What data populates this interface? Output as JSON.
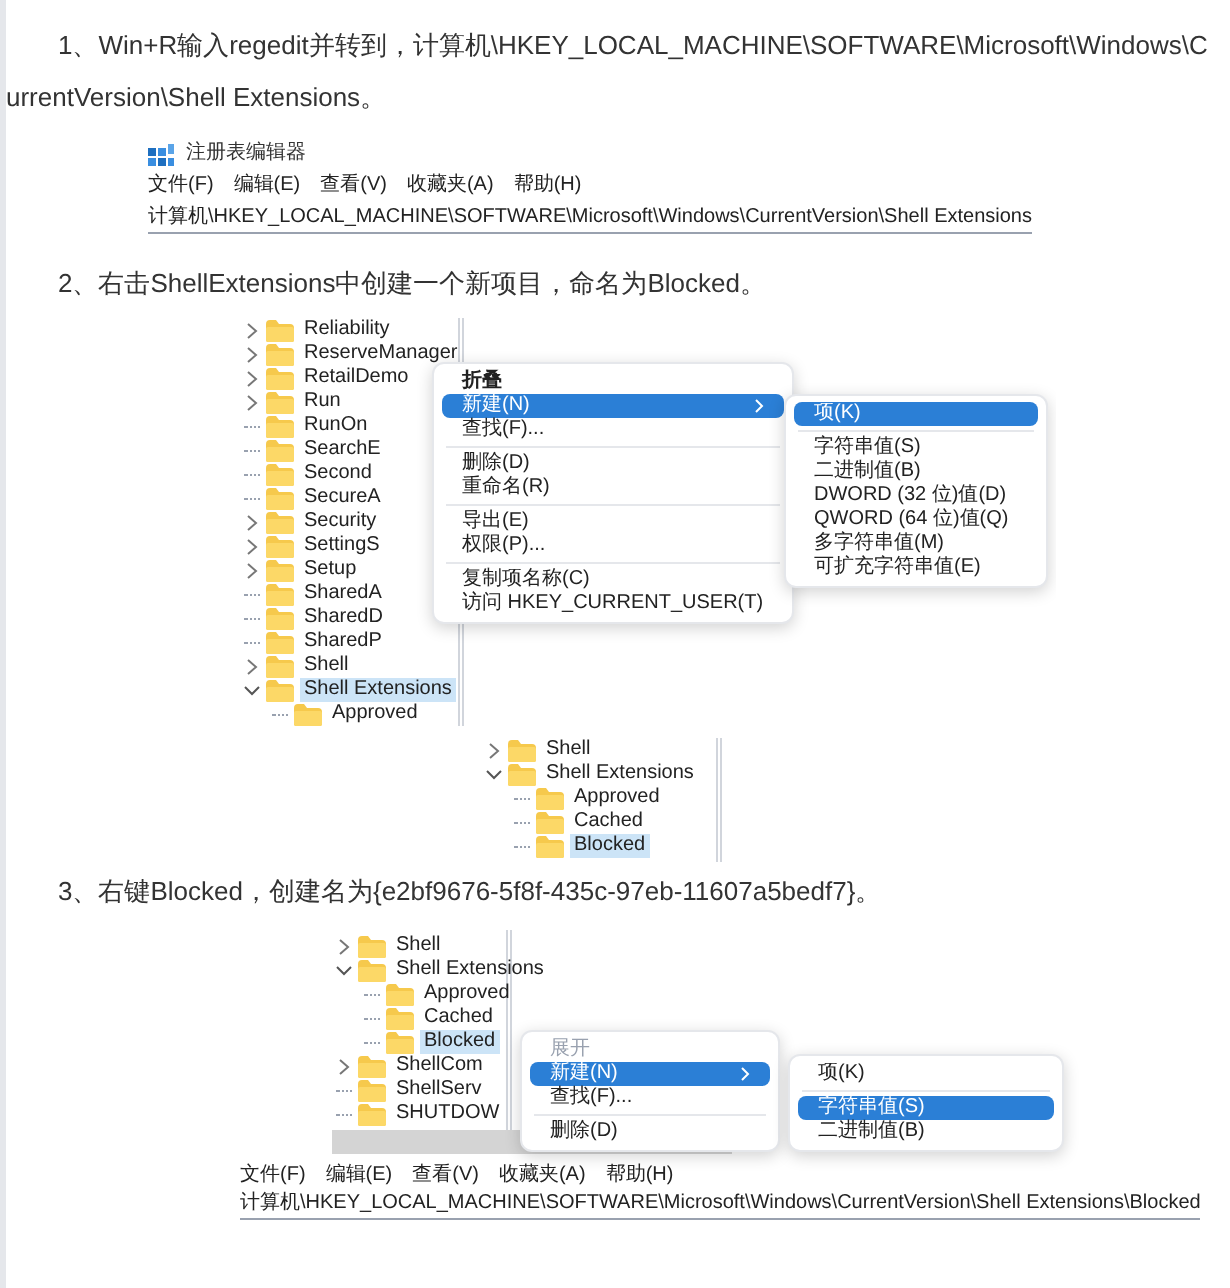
{
  "blocks": [
    {
      "kind": "paragraph",
      "text": "1、Win+R输入regedit并转到，计算机\\HKEY_LOCAL_MACHINE\\SOFTWARE\\Microsoft\\Windows\\CurrentVersion\\Shell Extensions。"
    },
    {
      "kind": "regedit_header",
      "title": "注册表编辑器",
      "menus": [
        "文件(F)",
        "编辑(E)",
        "查看(V)",
        "收藏夹(A)",
        "帮助(H)"
      ],
      "path": "计算机\\HKEY_LOCAL_MACHINE\\SOFTWARE\\Microsoft\\Windows\\CurrentVersion\\Shell Extensions"
    },
    {
      "kind": "paragraph",
      "text": "2、右击ShellExtensions中创建一个新项目，命名为Blocked。"
    },
    {
      "kind": "menu_shot",
      "tree": [
        {
          "label": "Reliability",
          "expanded": false,
          "selected": false
        },
        {
          "label": "ReserveManager",
          "expanded": false,
          "selected": false
        },
        {
          "label": "RetailDemo",
          "expanded": false,
          "selected": false
        },
        {
          "label": "Run",
          "expanded": false,
          "selected": false
        },
        {
          "label": "RunOn",
          "selected": false
        },
        {
          "label": "SearchE",
          "selected": false
        },
        {
          "label": "Second",
          "selected": false
        },
        {
          "label": "SecureA",
          "selected": false
        },
        {
          "label": "Security",
          "expanded": false,
          "selected": false
        },
        {
          "label": "SettingS",
          "expanded": false,
          "selected": false
        },
        {
          "label": "Setup",
          "expanded": false,
          "selected": false
        },
        {
          "label": "SharedA",
          "selected": false
        },
        {
          "label": "SharedD",
          "selected": false
        },
        {
          "label": "SharedP",
          "selected": false
        },
        {
          "label": "Shell",
          "expanded": false,
          "selected": false
        },
        {
          "label": "Shell Extensions",
          "expanded": true,
          "selected": true,
          "children": [
            {
              "label": "Approved",
              "selected": false
            }
          ]
        }
      ],
      "menu": {
        "groups": [
          [
            {
              "label": "折叠",
              "bold": true,
              "disabled": false,
              "selected": false,
              "has_submenu": false
            },
            {
              "label": "新建(N)",
              "bold": false,
              "disabled": false,
              "selected": true,
              "has_submenu": true
            },
            {
              "label": "查找(F)...",
              "bold": false,
              "disabled": false,
              "selected": false,
              "has_submenu": false
            }
          ],
          [
            {
              "label": "删除(D)",
              "bold": false,
              "disabled": false,
              "selected": false,
              "has_submenu": false
            },
            {
              "label": "重命名(R)",
              "bold": false,
              "disabled": false,
              "selected": false,
              "has_submenu": false
            }
          ],
          [
            {
              "label": "导出(E)",
              "bold": false,
              "disabled": false,
              "selected": false,
              "has_submenu": false
            },
            {
              "label": "权限(P)...",
              "bold": false,
              "disabled": false,
              "selected": false,
              "has_submenu": false
            }
          ],
          [
            {
              "label": "复制项名称(C)",
              "bold": false,
              "disabled": false,
              "selected": false,
              "has_submenu": false
            },
            {
              "label": "访问 HKEY_CURRENT_USER(T)",
              "bold": false,
              "disabled": false,
              "selected": false,
              "has_submenu": false
            }
          ]
        ]
      },
      "submenu": {
        "groups": [
          [
            {
              "label": "项(K)",
              "bold": false,
              "disabled": false,
              "selected": true,
              "has_submenu": false
            }
          ],
          [
            {
              "label": "字符串值(S)",
              "bold": false,
              "disabled": false,
              "selected": false,
              "has_submenu": false
            },
            {
              "label": "二进制值(B)",
              "bold": false,
              "disabled": false,
              "selected": false,
              "has_submenu": false
            },
            {
              "label": "DWORD (32 位)值(D)",
              "bold": false,
              "disabled": false,
              "selected": false,
              "has_submenu": false
            },
            {
              "label": "QWORD (64 位)值(Q)",
              "bold": false,
              "disabled": false,
              "selected": false,
              "has_submenu": false
            },
            {
              "label": "多字符串值(M)",
              "bold": false,
              "disabled": false,
              "selected": false,
              "has_submenu": false
            },
            {
              "label": "可扩充字符串值(E)",
              "bold": false,
              "disabled": false,
              "selected": false,
              "has_submenu": false
            }
          ]
        ]
      }
    },
    {
      "kind": "tree_shot",
      "tree": [
        {
          "label": "Shell",
          "expanded": false,
          "selected": false
        },
        {
          "label": "Shell Extensions",
          "expanded": true,
          "selected": false,
          "children": [
            {
              "label": "Approved",
              "selected": false
            },
            {
              "label": "Cached",
              "selected": false
            },
            {
              "label": "Blocked",
              "selected": true
            }
          ]
        }
      ]
    },
    {
      "kind": "paragraph",
      "text": "3、右键Blocked，创建名为{e2bf9676-5f8f-435c-97eb-11607a5bedf7}。"
    },
    {
      "kind": "menu_footer_shot",
      "tree": [
        {
          "label": "Shell",
          "expanded": false,
          "selected": false
        },
        {
          "label": "Shell Extensions",
          "expanded": true,
          "selected": false,
          "children": [
            {
              "label": "Approved",
              "selected": false
            },
            {
              "label": "Cached",
              "selected": false
            },
            {
              "label": "Blocked",
              "selected": true
            }
          ]
        },
        {
          "label": "ShellCom",
          "expanded": false,
          "selected": false
        },
        {
          "label": "ShellServ",
          "selected": false
        },
        {
          "label": "SHUTDOW",
          "selected": false
        }
      ],
      "menu": {
        "groups": [
          [
            {
              "label": "展开",
              "bold": false,
              "disabled": true,
              "selected": false,
              "has_submenu": false
            },
            {
              "label": "新建(N)",
              "bold": false,
              "disabled": false,
              "selected": true,
              "has_submenu": true
            },
            {
              "label": "查找(F)...",
              "bold": false,
              "disabled": false,
              "selected": false,
              "has_submenu": false
            }
          ],
          [
            {
              "label": "删除(D)",
              "bold": false,
              "disabled": false,
              "selected": false,
              "has_submenu": false
            }
          ]
        ]
      },
      "submenu": {
        "groups": [
          [
            {
              "label": "项(K)",
              "bold": false,
              "disabled": false,
              "selected": false,
              "has_submenu": false
            }
          ],
          [
            {
              "label": "字符串值(S)",
              "bold": false,
              "disabled": false,
              "selected": true,
              "has_submenu": false
            },
            {
              "label": "二进制值(B)",
              "bold": false,
              "disabled": false,
              "selected": false,
              "has_submenu": false
            }
          ]
        ]
      },
      "menus": [
        "文件(F)",
        "编辑(E)",
        "查看(V)",
        "收藏夹(A)",
        "帮助(H)"
      ],
      "path": "计算机\\HKEY_LOCAL_MACHINE\\SOFTWARE\\Microsoft\\Windows\\CurrentVersion\\Shell Extensions\\Blocked"
    }
  ]
}
